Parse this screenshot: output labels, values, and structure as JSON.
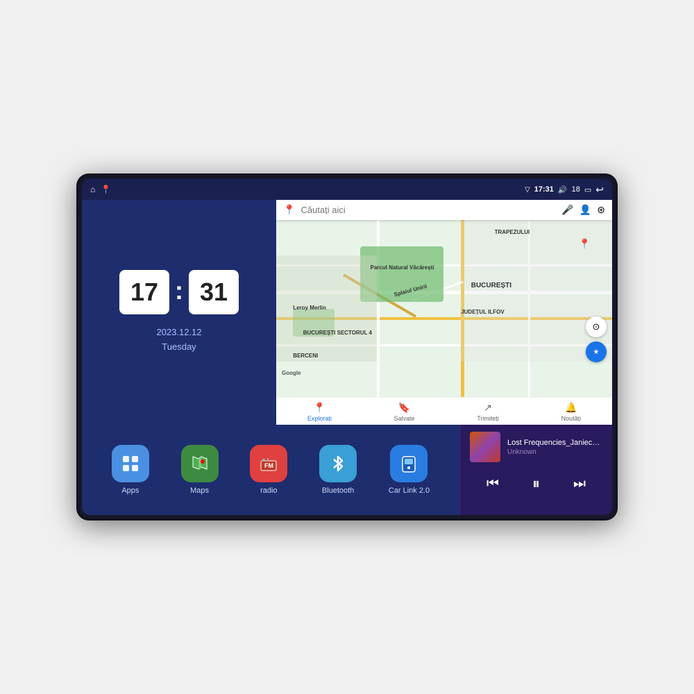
{
  "device": {
    "status_bar": {
      "signal_icon": "▽",
      "time": "17:31",
      "volume_icon": "🔊",
      "battery_level": "18",
      "battery_icon": "▭",
      "back_icon": "↩",
      "home_icon": "⌂",
      "maps_icon": "📍"
    },
    "clock": {
      "hours": "17",
      "minutes": "31",
      "date": "2023.12.12",
      "day": "Tuesday"
    },
    "map": {
      "search_placeholder": "Căutați aici",
      "nav_items": [
        {
          "label": "Explorați",
          "active": true
        },
        {
          "label": "Salvate",
          "active": false
        },
        {
          "label": "Trimiteți",
          "active": false
        },
        {
          "label": "Noutăți",
          "active": false
        }
      ],
      "labels": [
        "Parcul Natural Văcărești",
        "Leroy Merlin",
        "BUCUREȘTI SECTORUL 4",
        "BUCUREȘTI",
        "JUDEȚUL ILFOV",
        "TRAPEZULUI",
        "BERCENI",
        "Google"
      ]
    },
    "apps": [
      {
        "id": "apps",
        "label": "Apps",
        "icon": "⊞",
        "color": "app-icon-apps"
      },
      {
        "id": "maps",
        "label": "Maps",
        "icon": "🗺",
        "color": "app-icon-maps"
      },
      {
        "id": "radio",
        "label": "radio",
        "icon": "📻",
        "color": "app-icon-radio"
      },
      {
        "id": "bluetooth",
        "label": "Bluetooth",
        "icon": "⬡",
        "color": "app-icon-bluetooth"
      },
      {
        "id": "carlink",
        "label": "Car Link 2.0",
        "icon": "📱",
        "color": "app-icon-carlink"
      }
    ],
    "music": {
      "title": "Lost Frequencies_Janieck Devy-...",
      "artist": "Unknown",
      "prev_label": "⏮",
      "play_label": "⏸",
      "next_label": "⏭"
    }
  }
}
